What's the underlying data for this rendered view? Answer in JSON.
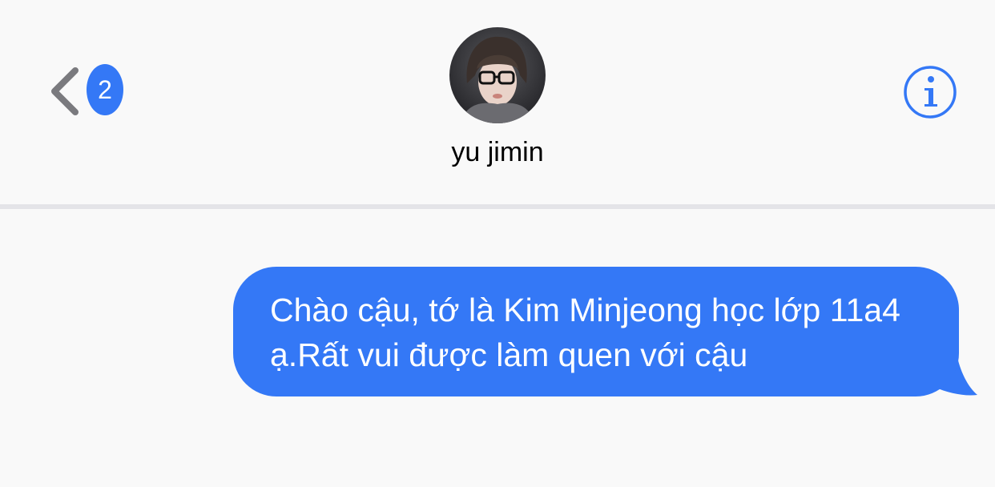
{
  "header": {
    "back": {
      "icon": "chevron-left-icon",
      "unread_count": "2"
    },
    "contact": {
      "name": "yu jimin",
      "avatar": "contact-photo"
    },
    "info": {
      "icon": "info-circle-icon"
    }
  },
  "conversation": {
    "messages": [
      {
        "direction": "outgoing",
        "text": "Chào cậu, tớ là Kim Minjeong học lớp 11a4 ạ.Rất vui được làm quen với cậu"
      }
    ]
  },
  "colors": {
    "accent": "#3478f6",
    "chevron": "#7a7a7e",
    "background": "#f9f9f9",
    "divider": "#e4e4e8"
  }
}
